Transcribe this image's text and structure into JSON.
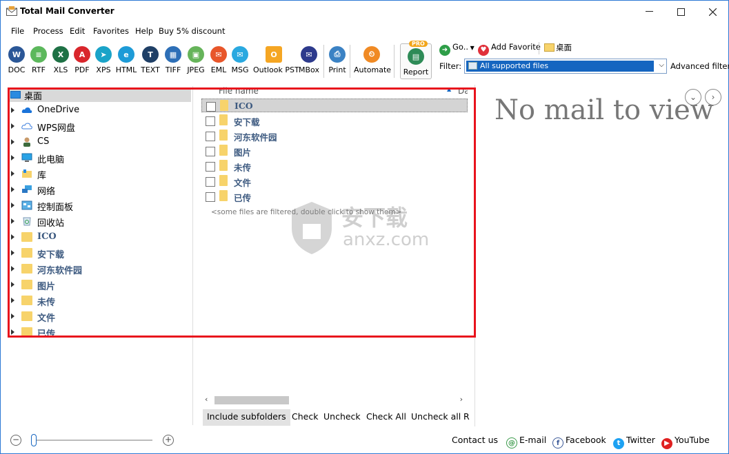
{
  "window": {
    "title": "Total Mail Converter"
  },
  "menu": [
    "File",
    "Process",
    "Edit",
    "Favorites",
    "Help",
    "Buy 5% discount"
  ],
  "toolbar": {
    "buttons": [
      {
        "label": "DOC",
        "icon": "word-icon",
        "color": "#2b5797",
        "glyph": "W"
      },
      {
        "label": "RTF",
        "icon": "rtf-icon",
        "color": "#5cb85c",
        "glyph": "≡"
      },
      {
        "label": "XLS",
        "icon": "excel-icon",
        "color": "#1e7145",
        "glyph": "X"
      },
      {
        "label": "PDF",
        "icon": "pdf-icon",
        "color": "#d9262c",
        "glyph": "A"
      },
      {
        "label": "XPS",
        "icon": "xps-icon",
        "color": "#1aa3c8",
        "glyph": "➤"
      },
      {
        "label": "HTML",
        "icon": "html-icon",
        "color": "#1e9bd7",
        "glyph": "e"
      },
      {
        "label": "TEXT",
        "icon": "text-icon",
        "color": "#1f3f66",
        "glyph": "T"
      },
      {
        "label": "TIFF",
        "icon": "tiff-icon",
        "color": "#2d6fb7",
        "glyph": "▦"
      },
      {
        "label": "JPEG",
        "icon": "jpeg-icon",
        "color": "#66b45a",
        "glyph": "▣"
      },
      {
        "label": "EML",
        "icon": "eml-icon",
        "color": "#e8562a",
        "glyph": "✉"
      },
      {
        "label": "MSG",
        "icon": "msg-icon",
        "color": "#2aa9e0",
        "glyph": "✉"
      },
      {
        "label": "Outlook PST",
        "icon": "outlook-pst-icon",
        "color": "#f5a623",
        "glyph": "O"
      },
      {
        "label": "MBox",
        "icon": "mbox-icon",
        "color": "#2d3a8c",
        "glyph": "✉"
      },
      {
        "label": "Print",
        "icon": "printer-icon",
        "color": "#3b82c4",
        "glyph": "⎙"
      },
      {
        "label": "Automate",
        "icon": "automate-icon",
        "color": "#f08a24",
        "glyph": "⏲"
      },
      {
        "label": "Report",
        "icon": "report-icon",
        "color": "#2e8b57",
        "glyph": "▤"
      }
    ],
    "pro_badge": "PRO",
    "go_label": "Go..",
    "add_favorite_label": "Add Favorite",
    "current_folder": "桌面",
    "filter_label": "Filter:",
    "filter_value": "All supported files",
    "advanced_filter": "Advanced filter"
  },
  "tree": {
    "root": "桌面",
    "items": [
      {
        "label": "OneDrive",
        "icon": "onedrive-icon"
      },
      {
        "label": "WPS网盘",
        "icon": "cloud-icon"
      },
      {
        "label": "CS",
        "icon": "user-icon"
      },
      {
        "label": "此电脑",
        "icon": "computer-icon"
      },
      {
        "label": "库",
        "icon": "library-icon"
      },
      {
        "label": "网络",
        "icon": "network-icon"
      },
      {
        "label": "控制面板",
        "icon": "control-panel-icon"
      },
      {
        "label": "回收站",
        "icon": "recycle-bin-icon"
      },
      {
        "label": "ICO",
        "icon": "folder-icon"
      },
      {
        "label": "安下载",
        "icon": "folder-icon"
      },
      {
        "label": "河东软件园",
        "icon": "folder-icon"
      },
      {
        "label": "图片",
        "icon": "folder-icon"
      },
      {
        "label": "未传",
        "icon": "folder-icon"
      },
      {
        "label": "文件",
        "icon": "folder-icon"
      },
      {
        "label": "已传",
        "icon": "folder-icon"
      }
    ]
  },
  "filelist": {
    "col_name": "File name",
    "col_date": "Da",
    "files": [
      "ICO",
      "安下载",
      "河东软件园",
      "图片",
      "未传",
      "文件",
      "已传"
    ],
    "filtered_note": "<some files are filtered, double click to show them>"
  },
  "bottom": {
    "include_subfolders": "Include subfolders",
    "check": "Check",
    "uncheck": "Uncheck",
    "check_all": "Check All",
    "uncheck_all": "Uncheck all",
    "more": "R"
  },
  "viewer": {
    "empty_text": "No mail to view"
  },
  "status": {
    "contact": "Contact us",
    "email": "E-mail",
    "facebook": "Facebook",
    "twitter": "Twitter",
    "youtube": "YouTube"
  },
  "watermark": {
    "text_cn": "安下载",
    "text_en": "anxz.com"
  },
  "colors": {
    "accent": "#1565c0",
    "highlight_frame": "#e8121c",
    "folder": "#f7d36b"
  }
}
